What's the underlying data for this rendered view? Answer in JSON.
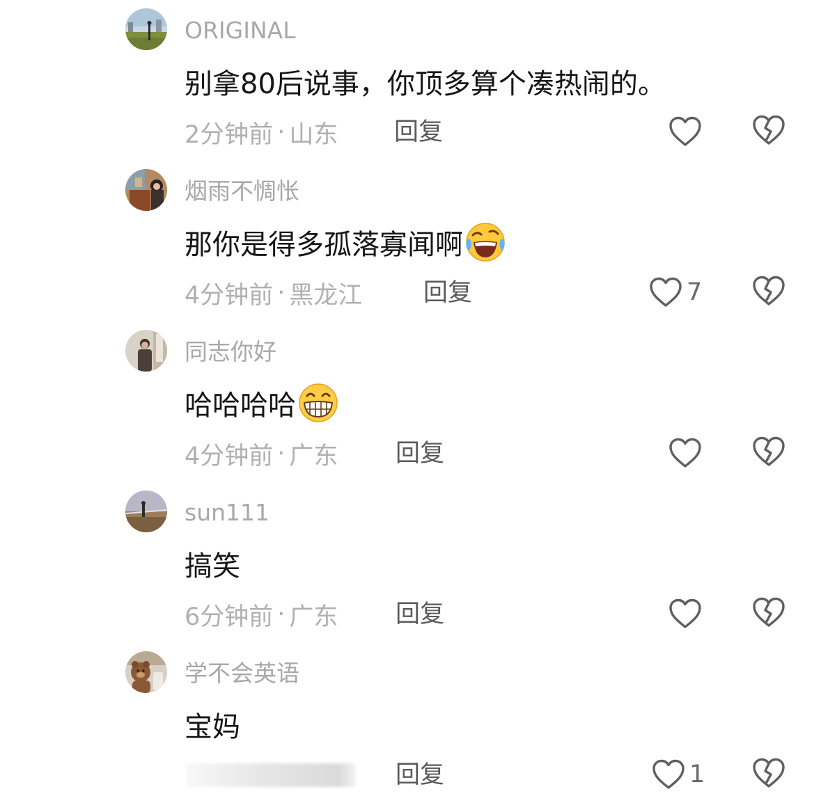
{
  "comments": [
    {
      "username": "ORIGINAL",
      "text": "别拿80后说事，你顶多算个凑热闹的。",
      "emoji": "",
      "time": "2分钟前",
      "separator": "·",
      "location": "山东",
      "reply_label": "回复",
      "like_count": "",
      "avatar": "avatar-landscape-person"
    },
    {
      "username": "烟雨不惆怅",
      "text": "那你是得多孤落寡闻啊",
      "emoji": "rolling-laughing-emoji",
      "time": "4分钟前",
      "separator": "·",
      "location": "黑龙江",
      "reply_label": "回复",
      "like_count": "7",
      "avatar": "avatar-indoor-woman"
    },
    {
      "username": "同志你好",
      "text": "哈哈哈哈",
      "emoji": "grinning-emoji",
      "time": "4分钟前",
      "separator": "·",
      "location": "广东",
      "reply_label": "回复",
      "like_count": "",
      "avatar": "avatar-man-standing"
    },
    {
      "username": "sun111",
      "text": "搞笑",
      "emoji": "",
      "time": "6分钟前",
      "separator": "·",
      "location": "广东",
      "reply_label": "回复",
      "like_count": "",
      "avatar": "avatar-sunset-field"
    },
    {
      "username": "学不会英语",
      "text": "宝妈",
      "emoji": "",
      "time": "",
      "separator": "",
      "location": "",
      "reply_label": "回复",
      "like_count": "1",
      "avatar": "avatar-teddy-bear",
      "meta_redacted": true
    }
  ],
  "colors": {
    "username": "#a8a8a8",
    "content": "#161616",
    "meta": "#b0b0b0",
    "reply": "#5a5a5a",
    "icon_stroke": "#5f5f5f"
  }
}
